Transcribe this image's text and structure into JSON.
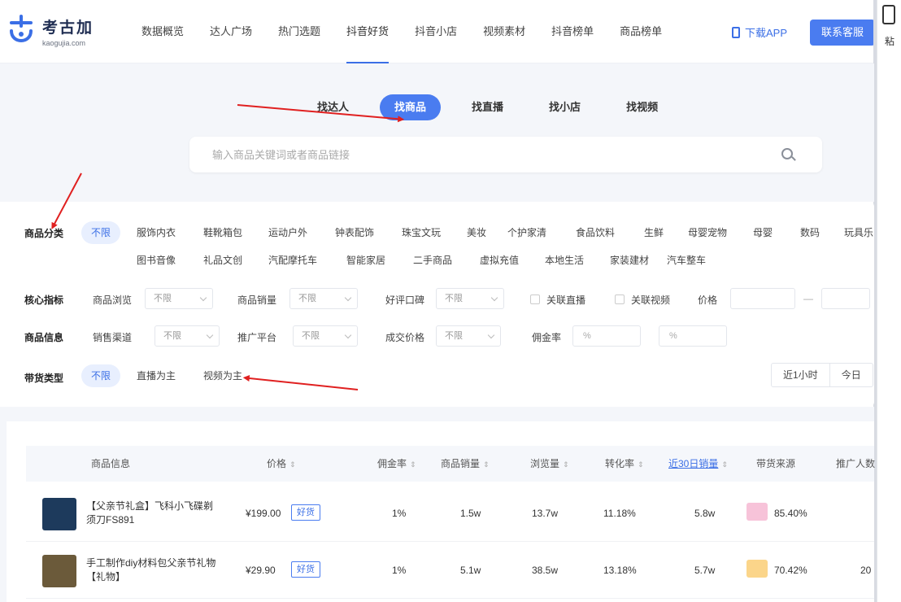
{
  "brand": {
    "name": "考古加",
    "domain": "kaogujia.com"
  },
  "nav": {
    "items": [
      "数据概览",
      "达人广场",
      "热门选题",
      "抖音好货",
      "抖音小店",
      "视频素材",
      "抖音榜单",
      "商品榜单"
    ],
    "active_index": 3,
    "download_label": "下载APP",
    "contact_label": "联系客服"
  },
  "rail": {
    "text": "粘"
  },
  "search": {
    "tabs": [
      "找达人",
      "找商品",
      "找直播",
      "找小店",
      "找视频"
    ],
    "active_tab": 1,
    "placeholder": "输入商品关键词或者商品链接"
  },
  "filters": {
    "category_label": "商品分类",
    "category_all": "不限",
    "categories_row1": [
      "服饰内衣",
      "鞋靴箱包",
      "运动户外",
      "钟表配饰",
      "珠宝文玩",
      "美妆",
      "个护家清",
      "食品饮料",
      "生鲜",
      "母婴宠物",
      "母婴",
      "数码",
      "玩具乐"
    ],
    "categories_row2": [
      "图书音像",
      "礼品文创",
      "汽配摩托车",
      "智能家居",
      "二手商品",
      "虚拟充值",
      "本地生活",
      "家装建材",
      "汽车整车"
    ],
    "core_label": "核心指标",
    "core": [
      {
        "label": "商品浏览",
        "value": "不限"
      },
      {
        "label": "商品销量",
        "value": "不限"
      },
      {
        "label": "好评口碑",
        "value": "不限"
      }
    ],
    "check_live": "关联直播",
    "check_video": "关联视频",
    "price_label": "价格",
    "price_sep": "—",
    "info_label": "商品信息",
    "info": [
      {
        "label": "销售渠道",
        "value": "不限"
      },
      {
        "label": "推广平台",
        "value": "不限"
      },
      {
        "label": "成交价格",
        "value": "不限"
      }
    ],
    "commission_label": "佣金率",
    "commission_min": "%",
    "commission_max": "%",
    "type_label": "带货类型",
    "type_options": [
      "不限",
      "直播为主",
      "视频为主"
    ],
    "type_active": 0,
    "time_options": [
      "近1小时",
      "今日"
    ]
  },
  "table": {
    "headers": [
      {
        "label": "商品信息",
        "sortable": false,
        "highlight": false
      },
      {
        "label": "价格",
        "sortable": true,
        "highlight": false
      },
      {
        "label": "佣金率",
        "sortable": true,
        "highlight": false
      },
      {
        "label": "商品销量",
        "sortable": true,
        "highlight": false
      },
      {
        "label": "浏览量",
        "sortable": true,
        "highlight": false
      },
      {
        "label": "转化率",
        "sortable": true,
        "highlight": false
      },
      {
        "label": "近30日销量",
        "sortable": true,
        "highlight": true
      },
      {
        "label": "带货来源",
        "sortable": false,
        "highlight": false
      },
      {
        "label": "推广人数",
        "sortable": false,
        "highlight": false
      }
    ],
    "rows": [
      {
        "name": "【父亲节礼盒】飞科小飞碟剃须刀FS891",
        "price": "¥199.00",
        "tag": "好货",
        "commission": "1%",
        "sales": "1.5w",
        "views": "13.7w",
        "conversion": "11.18%",
        "sales30": "5.8w",
        "source_pct": "85.40%",
        "source_color": "#f7c3d9",
        "promoters": "",
        "thumb_color": "#1d3a5c"
      },
      {
        "name": "手工制作diy材料包父亲节礼物【礼物】",
        "price": "¥29.90",
        "tag": "好货",
        "commission": "1%",
        "sales": "5.1w",
        "views": "38.5w",
        "conversion": "13.18%",
        "sales30": "5.7w",
        "source_pct": "70.42%",
        "source_color": "#fbd58a",
        "promoters": "20",
        "thumb_color": "#6b5a3a"
      }
    ]
  },
  "colors": {
    "accent": "#4a7cf0",
    "annotation": "#e02020"
  }
}
